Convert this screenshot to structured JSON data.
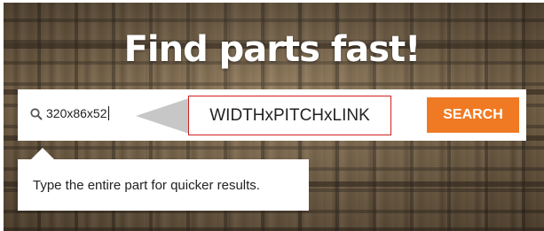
{
  "hero": {
    "headline": "Find parts fast!"
  },
  "search": {
    "value": "320x86x52",
    "icon": "search-icon",
    "hint": "WIDTHxPITCHxLINK",
    "button_label": "SEARCH",
    "tooltip": "Type the entire part for quicker results."
  },
  "colors": {
    "accent": "#f07a23",
    "hint_border": "#d21f1f",
    "arrow": "#c7c7c7"
  }
}
